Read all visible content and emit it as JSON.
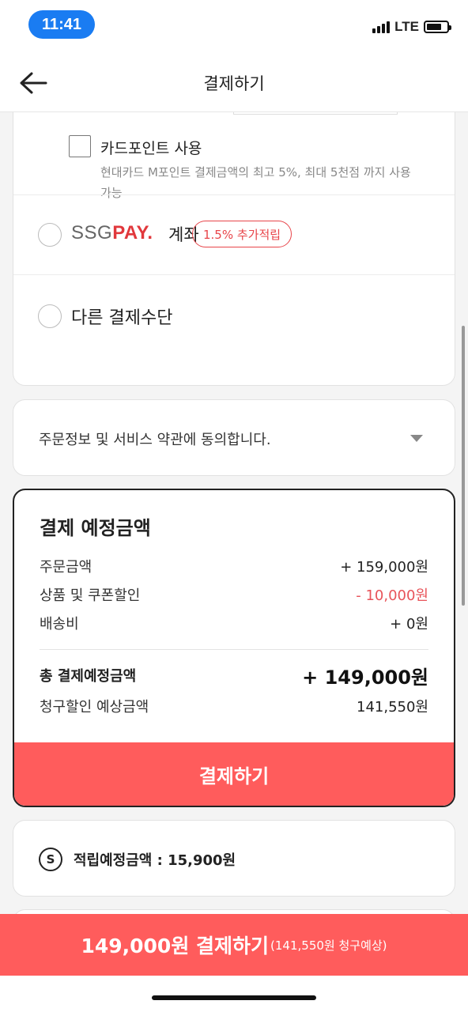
{
  "status_bar": {
    "time": "11:41",
    "network": "LTE"
  },
  "header": {
    "title": "결제하기"
  },
  "payment_methods": {
    "card_point": {
      "label": "카드포인트 사용",
      "description": "현대카드 M포인트 결제금액의 최고 5%, 최대 5천점 까지 사용가능",
      "checked": false
    },
    "ssgpay": {
      "logo_ssg": "SSG",
      "logo_pay": "PAY.",
      "suffix": "계좌",
      "badge": "1.5% 추가적립",
      "selected": false
    },
    "other": {
      "label": "다른 결제수단",
      "selected": false
    }
  },
  "agreement": {
    "text": "주문정보 및 서비스 약관에 동의합니다."
  },
  "summary": {
    "title": "결제 예정금액",
    "rows": [
      {
        "label": "주문금액",
        "value": "+ 159,000원"
      },
      {
        "label": "상품 및 쿠폰할인",
        "value": "- 10,000원"
      },
      {
        "label": "배송비",
        "value": "+ 0원"
      }
    ],
    "total": {
      "label": "총 결제예정금액",
      "value": "+ 149,000원"
    },
    "billing": {
      "label": "청구할인 예상금액",
      "value": "141,550원"
    },
    "pay_button": "결제하기"
  },
  "points": {
    "icon_letter": "S",
    "text": "적립예정금액 : 15,900원"
  },
  "bottom_bar": {
    "main": "149,000원 결제하기",
    "sub": "(141,550원 청구예상)"
  },
  "colors": {
    "accent": "#ff5c5c",
    "discount": "#e8545a",
    "time_pill": "#1a7cf2"
  }
}
